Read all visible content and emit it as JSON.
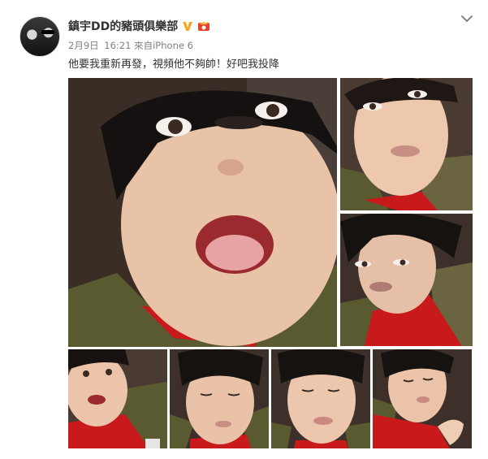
{
  "post": {
    "author": "鎮宇DD的豬頭俱樂部",
    "date": "2月9日",
    "time": "16:21",
    "source": "來自iPhone 6",
    "text": "他要我重新再發，視頻他不夠帥！好吧我投降"
  },
  "icons": {
    "avatar": "avatar-image",
    "verified": "verified-v-icon",
    "vip": "vip-badge-icon",
    "menu": "chevron-down-icon"
  },
  "colors": {
    "verified": "#f5a623",
    "vip": "#e8412a",
    "text": "#333333",
    "meta": "#808080",
    "jacket_red": "#c8191b",
    "camo_green": "#5a5a30"
  },
  "photos": [
    {
      "id": 1,
      "alt": "child open mouth close-up"
    },
    {
      "id": 2,
      "alt": "child looking sideways"
    },
    {
      "id": 3,
      "alt": "child pouting"
    },
    {
      "id": 4,
      "alt": "child small top-left"
    },
    {
      "id": 5,
      "alt": "child looking down"
    },
    {
      "id": 6,
      "alt": "child eyes down"
    },
    {
      "id": 7,
      "alt": "child looking down hand"
    }
  ]
}
